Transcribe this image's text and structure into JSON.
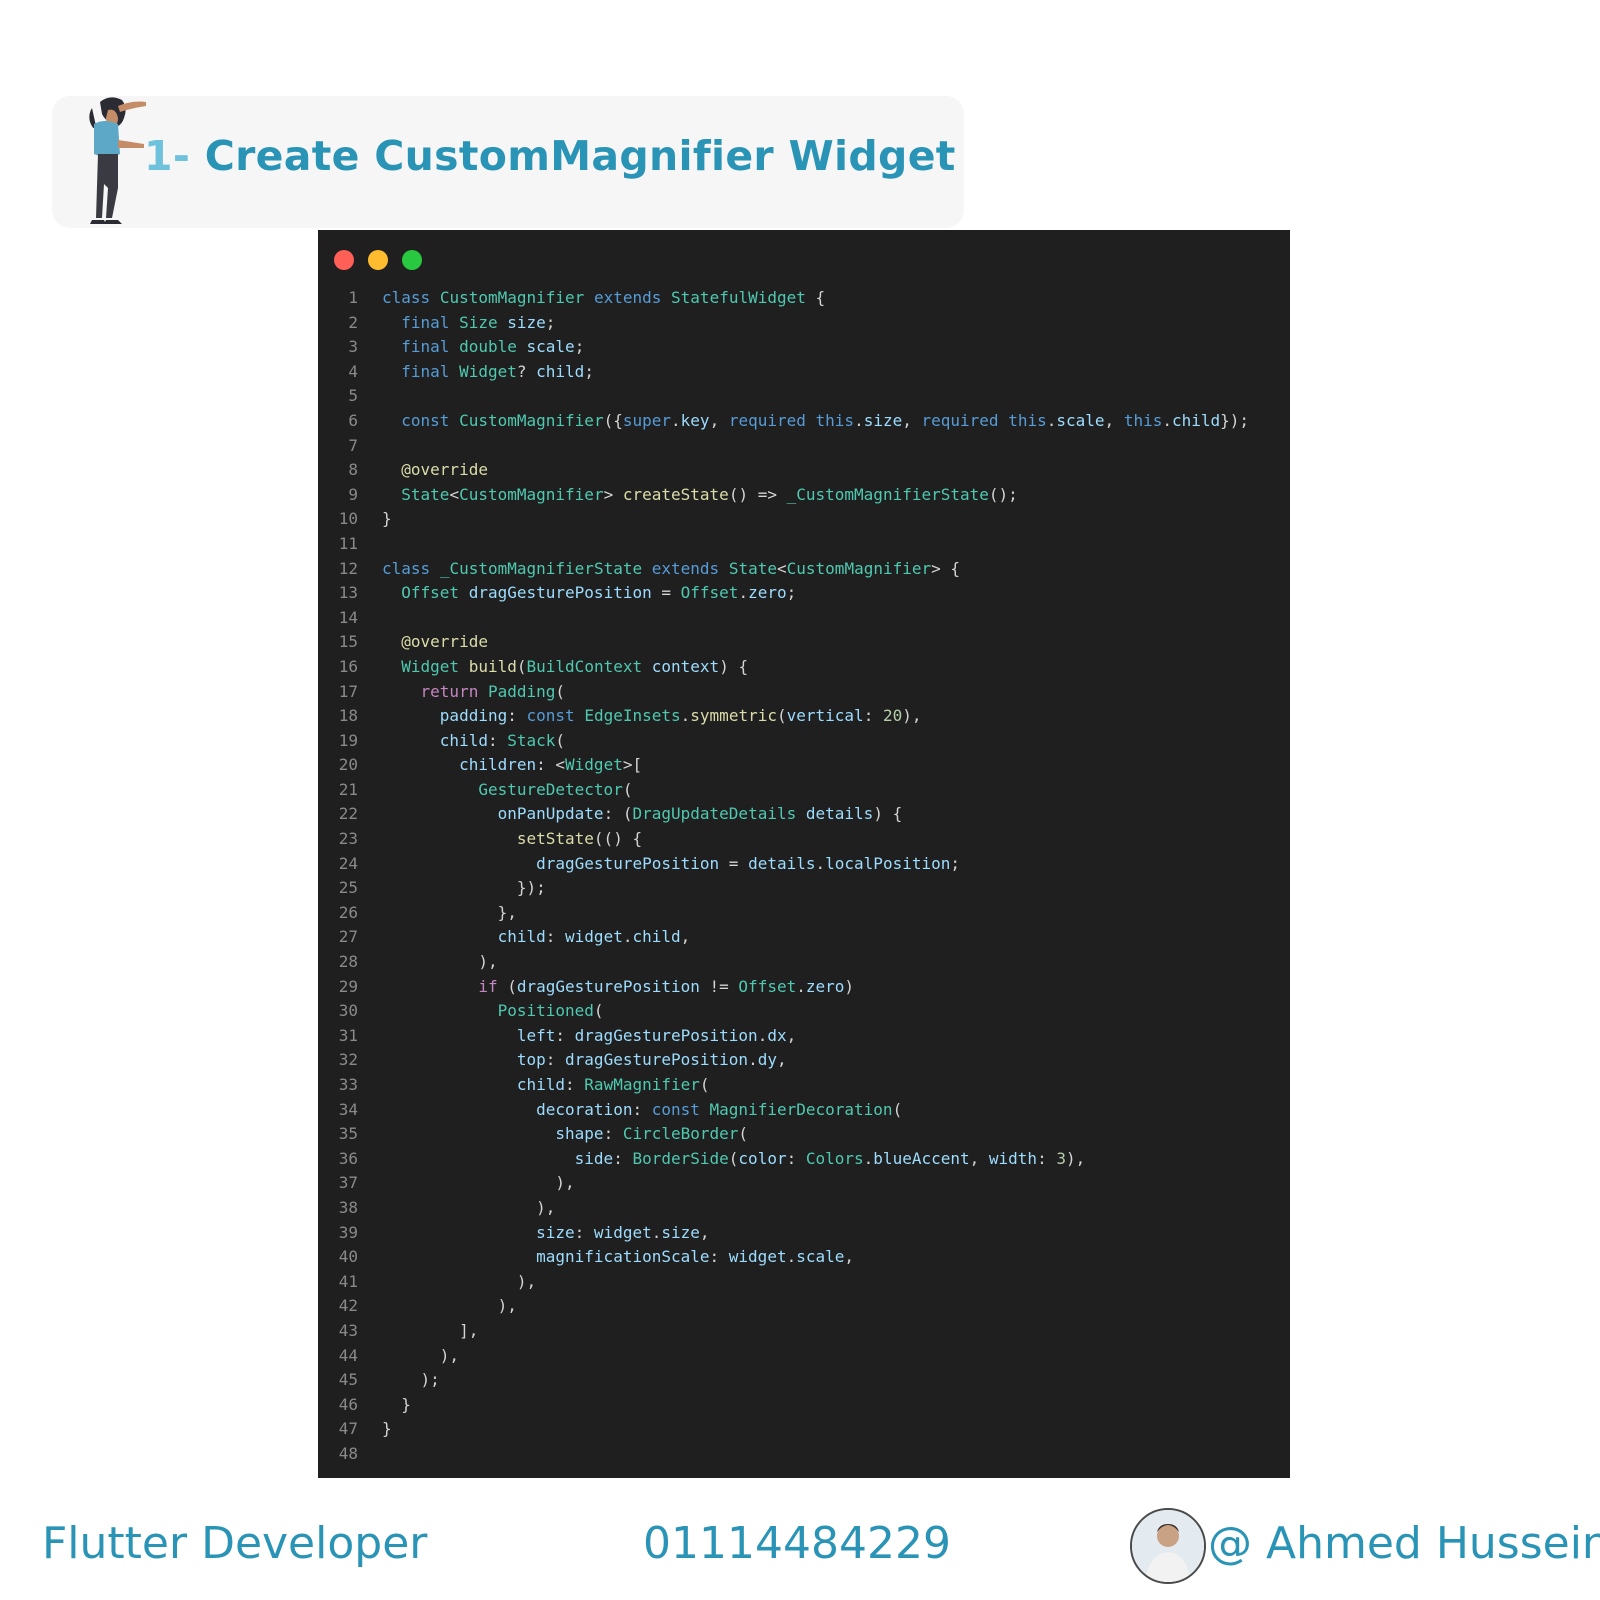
{
  "header": {
    "title_number": "1-",
    "title_text": "Create CustomMagnifier Widget"
  },
  "window": {
    "controls": [
      "close-dot",
      "minimize-dot",
      "zoom-dot"
    ]
  },
  "code_lines": [
    [
      {
        "t": "class",
        "c": "kw"
      },
      {
        "t": " "
      },
      {
        "t": "CustomMagnifier",
        "c": "typ"
      },
      {
        "t": " "
      },
      {
        "t": "extends",
        "c": "kw"
      },
      {
        "t": " "
      },
      {
        "t": "StatefulWidget",
        "c": "typ"
      },
      {
        "t": " {"
      }
    ],
    [
      {
        "t": "  "
      },
      {
        "t": "final",
        "c": "kw"
      },
      {
        "t": " "
      },
      {
        "t": "Size",
        "c": "typ"
      },
      {
        "t": " "
      },
      {
        "t": "size",
        "c": "var"
      },
      {
        "t": ";"
      }
    ],
    [
      {
        "t": "  "
      },
      {
        "t": "final",
        "c": "kw"
      },
      {
        "t": " "
      },
      {
        "t": "double",
        "c": "typ"
      },
      {
        "t": " "
      },
      {
        "t": "scale",
        "c": "var"
      },
      {
        "t": ";"
      }
    ],
    [
      {
        "t": "  "
      },
      {
        "t": "final",
        "c": "kw"
      },
      {
        "t": " "
      },
      {
        "t": "Widget",
        "c": "typ"
      },
      {
        "t": "? "
      },
      {
        "t": "child",
        "c": "var"
      },
      {
        "t": ";"
      }
    ],
    [],
    [
      {
        "t": "  "
      },
      {
        "t": "const",
        "c": "kw"
      },
      {
        "t": " "
      },
      {
        "t": "CustomMagnifier",
        "c": "typ"
      },
      {
        "t": "({"
      },
      {
        "t": "super",
        "c": "kw"
      },
      {
        "t": "."
      },
      {
        "t": "key",
        "c": "var"
      },
      {
        "t": ", "
      },
      {
        "t": "required",
        "c": "kw"
      },
      {
        "t": " "
      },
      {
        "t": "this",
        "c": "kw"
      },
      {
        "t": "."
      },
      {
        "t": "size",
        "c": "var"
      },
      {
        "t": ", "
      },
      {
        "t": "required",
        "c": "kw"
      },
      {
        "t": " "
      },
      {
        "t": "this",
        "c": "kw"
      },
      {
        "t": "."
      },
      {
        "t": "scale",
        "c": "var"
      },
      {
        "t": ", "
      },
      {
        "t": "this",
        "c": "kw"
      },
      {
        "t": "."
      },
      {
        "t": "child",
        "c": "var"
      },
      {
        "t": "});"
      }
    ],
    [],
    [
      {
        "t": "  "
      },
      {
        "t": "@override",
        "c": "fn"
      }
    ],
    [
      {
        "t": "  "
      },
      {
        "t": "State",
        "c": "typ"
      },
      {
        "t": "<"
      },
      {
        "t": "CustomMagnifier",
        "c": "typ"
      },
      {
        "t": "> "
      },
      {
        "t": "createState",
        "c": "fn"
      },
      {
        "t": "() => "
      },
      {
        "t": "_CustomMagnifierState",
        "c": "typ"
      },
      {
        "t": "();"
      }
    ],
    [
      {
        "t": "}"
      }
    ],
    [],
    [
      {
        "t": "class",
        "c": "kw"
      },
      {
        "t": " "
      },
      {
        "t": "_CustomMagnifierState",
        "c": "typ"
      },
      {
        "t": " "
      },
      {
        "t": "extends",
        "c": "kw"
      },
      {
        "t": " "
      },
      {
        "t": "State",
        "c": "typ"
      },
      {
        "t": "<"
      },
      {
        "t": "CustomMagnifier",
        "c": "typ"
      },
      {
        "t": "> {"
      }
    ],
    [
      {
        "t": "  "
      },
      {
        "t": "Offset",
        "c": "typ"
      },
      {
        "t": " "
      },
      {
        "t": "dragGesturePosition",
        "c": "var"
      },
      {
        "t": " = "
      },
      {
        "t": "Offset",
        "c": "typ"
      },
      {
        "t": "."
      },
      {
        "t": "zero",
        "c": "var"
      },
      {
        "t": ";"
      }
    ],
    [],
    [
      {
        "t": "  "
      },
      {
        "t": "@override",
        "c": "fn"
      }
    ],
    [
      {
        "t": "  "
      },
      {
        "t": "Widget",
        "c": "typ"
      },
      {
        "t": " "
      },
      {
        "t": "build",
        "c": "fn"
      },
      {
        "t": "("
      },
      {
        "t": "BuildContext",
        "c": "typ"
      },
      {
        "t": " "
      },
      {
        "t": "context",
        "c": "var"
      },
      {
        "t": ") {"
      }
    ],
    [
      {
        "t": "    "
      },
      {
        "t": "return",
        "c": "ctl"
      },
      {
        "t": " "
      },
      {
        "t": "Padding",
        "c": "typ"
      },
      {
        "t": "("
      }
    ],
    [
      {
        "t": "      "
      },
      {
        "t": "padding",
        "c": "var"
      },
      {
        "t": ": "
      },
      {
        "t": "const",
        "c": "kw"
      },
      {
        "t": " "
      },
      {
        "t": "EdgeInsets",
        "c": "typ"
      },
      {
        "t": "."
      },
      {
        "t": "symmetric",
        "c": "fn"
      },
      {
        "t": "("
      },
      {
        "t": "vertical",
        "c": "var"
      },
      {
        "t": ": "
      },
      {
        "t": "20",
        "c": "num2"
      },
      {
        "t": "),"
      }
    ],
    [
      {
        "t": "      "
      },
      {
        "t": "child",
        "c": "var"
      },
      {
        "t": ": "
      },
      {
        "t": "Stack",
        "c": "typ"
      },
      {
        "t": "("
      }
    ],
    [
      {
        "t": "        "
      },
      {
        "t": "children",
        "c": "var"
      },
      {
        "t": ": <"
      },
      {
        "t": "Widget",
        "c": "typ"
      },
      {
        "t": ">["
      }
    ],
    [
      {
        "t": "          "
      },
      {
        "t": "GestureDetector",
        "c": "typ"
      },
      {
        "t": "("
      }
    ],
    [
      {
        "t": "            "
      },
      {
        "t": "onPanUpdate",
        "c": "var"
      },
      {
        "t": ": ("
      },
      {
        "t": "DragUpdateDetails",
        "c": "typ"
      },
      {
        "t": " "
      },
      {
        "t": "details",
        "c": "var"
      },
      {
        "t": ") {"
      }
    ],
    [
      {
        "t": "              "
      },
      {
        "t": "setState",
        "c": "fn"
      },
      {
        "t": "(() {"
      }
    ],
    [
      {
        "t": "                "
      },
      {
        "t": "dragGesturePosition",
        "c": "var"
      },
      {
        "t": " = "
      },
      {
        "t": "details",
        "c": "var"
      },
      {
        "t": "."
      },
      {
        "t": "localPosition",
        "c": "var"
      },
      {
        "t": ";"
      }
    ],
    [
      {
        "t": "              });"
      }
    ],
    [
      {
        "t": "            },"
      }
    ],
    [
      {
        "t": "            "
      },
      {
        "t": "child",
        "c": "var"
      },
      {
        "t": ": "
      },
      {
        "t": "widget",
        "c": "var"
      },
      {
        "t": "."
      },
      {
        "t": "child",
        "c": "var"
      },
      {
        "t": ","
      }
    ],
    [
      {
        "t": "          ),"
      }
    ],
    [
      {
        "t": "          "
      },
      {
        "t": "if",
        "c": "ctl"
      },
      {
        "t": " ("
      },
      {
        "t": "dragGesturePosition",
        "c": "var"
      },
      {
        "t": " != "
      },
      {
        "t": "Offset",
        "c": "typ"
      },
      {
        "t": "."
      },
      {
        "t": "zero",
        "c": "var"
      },
      {
        "t": ")"
      }
    ],
    [
      {
        "t": "            "
      },
      {
        "t": "Positioned",
        "c": "typ"
      },
      {
        "t": "("
      }
    ],
    [
      {
        "t": "              "
      },
      {
        "t": "left",
        "c": "var"
      },
      {
        "t": ": "
      },
      {
        "t": "dragGesturePosition",
        "c": "var"
      },
      {
        "t": "."
      },
      {
        "t": "dx",
        "c": "var"
      },
      {
        "t": ","
      }
    ],
    [
      {
        "t": "              "
      },
      {
        "t": "top",
        "c": "var"
      },
      {
        "t": ": "
      },
      {
        "t": "dragGesturePosition",
        "c": "var"
      },
      {
        "t": "."
      },
      {
        "t": "dy",
        "c": "var"
      },
      {
        "t": ","
      }
    ],
    [
      {
        "t": "              "
      },
      {
        "t": "child",
        "c": "var"
      },
      {
        "t": ": "
      },
      {
        "t": "RawMagnifier",
        "c": "typ"
      },
      {
        "t": "("
      }
    ],
    [
      {
        "t": "                "
      },
      {
        "t": "decoration",
        "c": "var"
      },
      {
        "t": ": "
      },
      {
        "t": "const",
        "c": "kw"
      },
      {
        "t": " "
      },
      {
        "t": "MagnifierDecoration",
        "c": "typ"
      },
      {
        "t": "("
      }
    ],
    [
      {
        "t": "                  "
      },
      {
        "t": "shape",
        "c": "var"
      },
      {
        "t": ": "
      },
      {
        "t": "CircleBorder",
        "c": "typ"
      },
      {
        "t": "("
      }
    ],
    [
      {
        "t": "                    "
      },
      {
        "t": "side",
        "c": "var"
      },
      {
        "t": ": "
      },
      {
        "t": "BorderSide",
        "c": "typ"
      },
      {
        "t": "("
      },
      {
        "t": "color",
        "c": "var"
      },
      {
        "t": ": "
      },
      {
        "t": "Colors",
        "c": "typ"
      },
      {
        "t": "."
      },
      {
        "t": "blueAccent",
        "c": "var"
      },
      {
        "t": ", "
      },
      {
        "t": "width",
        "c": "var"
      },
      {
        "t": ": "
      },
      {
        "t": "3",
        "c": "num2"
      },
      {
        "t": "),"
      }
    ],
    [
      {
        "t": "                  ),"
      }
    ],
    [
      {
        "t": "                ),"
      }
    ],
    [
      {
        "t": "                "
      },
      {
        "t": "size",
        "c": "var"
      },
      {
        "t": ": "
      },
      {
        "t": "widget",
        "c": "var"
      },
      {
        "t": "."
      },
      {
        "t": "size",
        "c": "var"
      },
      {
        "t": ","
      }
    ],
    [
      {
        "t": "                "
      },
      {
        "t": "magnificationScale",
        "c": "var"
      },
      {
        "t": ": "
      },
      {
        "t": "widget",
        "c": "var"
      },
      {
        "t": "."
      },
      {
        "t": "scale",
        "c": "var"
      },
      {
        "t": ","
      }
    ],
    [
      {
        "t": "              ),"
      }
    ],
    [
      {
        "t": "            ),"
      }
    ],
    [
      {
        "t": "        ],"
      }
    ],
    [
      {
        "t": "      ),"
      }
    ],
    [
      {
        "t": "    );"
      }
    ],
    [
      {
        "t": "  }"
      }
    ],
    [
      {
        "t": "}"
      }
    ],
    []
  ],
  "footer": {
    "role": "Flutter Developer",
    "phone": "01114484229",
    "handle": "@ Ahmed Hussein"
  },
  "colors": {
    "accent": "#2a94b6",
    "code_bg": "#1f1f1f"
  }
}
